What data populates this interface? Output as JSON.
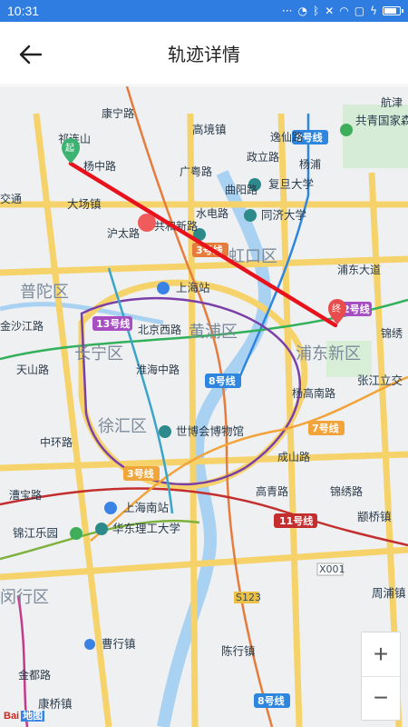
{
  "status": {
    "time": "10:31",
    "icons": [
      "more-icon",
      "alarm-icon",
      "bluetooth-icon",
      "mute-icon",
      "wifi-icon",
      "no-sim-icon",
      "charging-icon",
      "battery-icon"
    ]
  },
  "header": {
    "title": "轨迹详情",
    "back_icon": "arrow-left-icon"
  },
  "map": {
    "districts": [
      "普陀区",
      "长宁区",
      "徐汇区",
      "黄浦区",
      "虹口区",
      "浦东新区",
      "闵行区"
    ],
    "pois": [
      "高境镇",
      "复旦大学",
      "同济大学",
      "上海站",
      "世博会博物馆",
      "上海南站",
      "华东理工大学",
      "锦江乐园",
      "共青国家森林公园",
      "曹行镇",
      "陈行镇",
      "康桥镇",
      "周浦镇",
      "张江立交",
      "颛桥镇",
      "大场镇"
    ],
    "roads": [
      "沪太路",
      "康宁路",
      "祁连山",
      "交通",
      "逸仙路",
      "政立路",
      "广粤路",
      "曲阳路",
      "水电路",
      "共和新路",
      "沪太路",
      "杨中路",
      "北京西路",
      "淮海中路",
      "杨高南路",
      "成山路",
      "高青路",
      "锦绣路",
      "漕宝路",
      "中环路",
      "天山路",
      "金沙江路",
      "浦东大道",
      "金都路",
      "航津",
      "锦绣",
      "杨浦"
    ],
    "metro_lines": [
      "8号线",
      "3号线",
      "13号线",
      "8号线",
      "7号线",
      "3号线",
      "11号线",
      "2号线",
      "8号线"
    ],
    "highways": [
      "X001",
      "S123"
    ],
    "start_marker": "起",
    "end_marker": "终",
    "mid_marker": "",
    "track_color": "#e8121d",
    "attribution": {
      "brand": "Bai",
      "map_word": "地图"
    }
  },
  "zoom": {
    "zoom_in": "+",
    "zoom_out": "−"
  }
}
